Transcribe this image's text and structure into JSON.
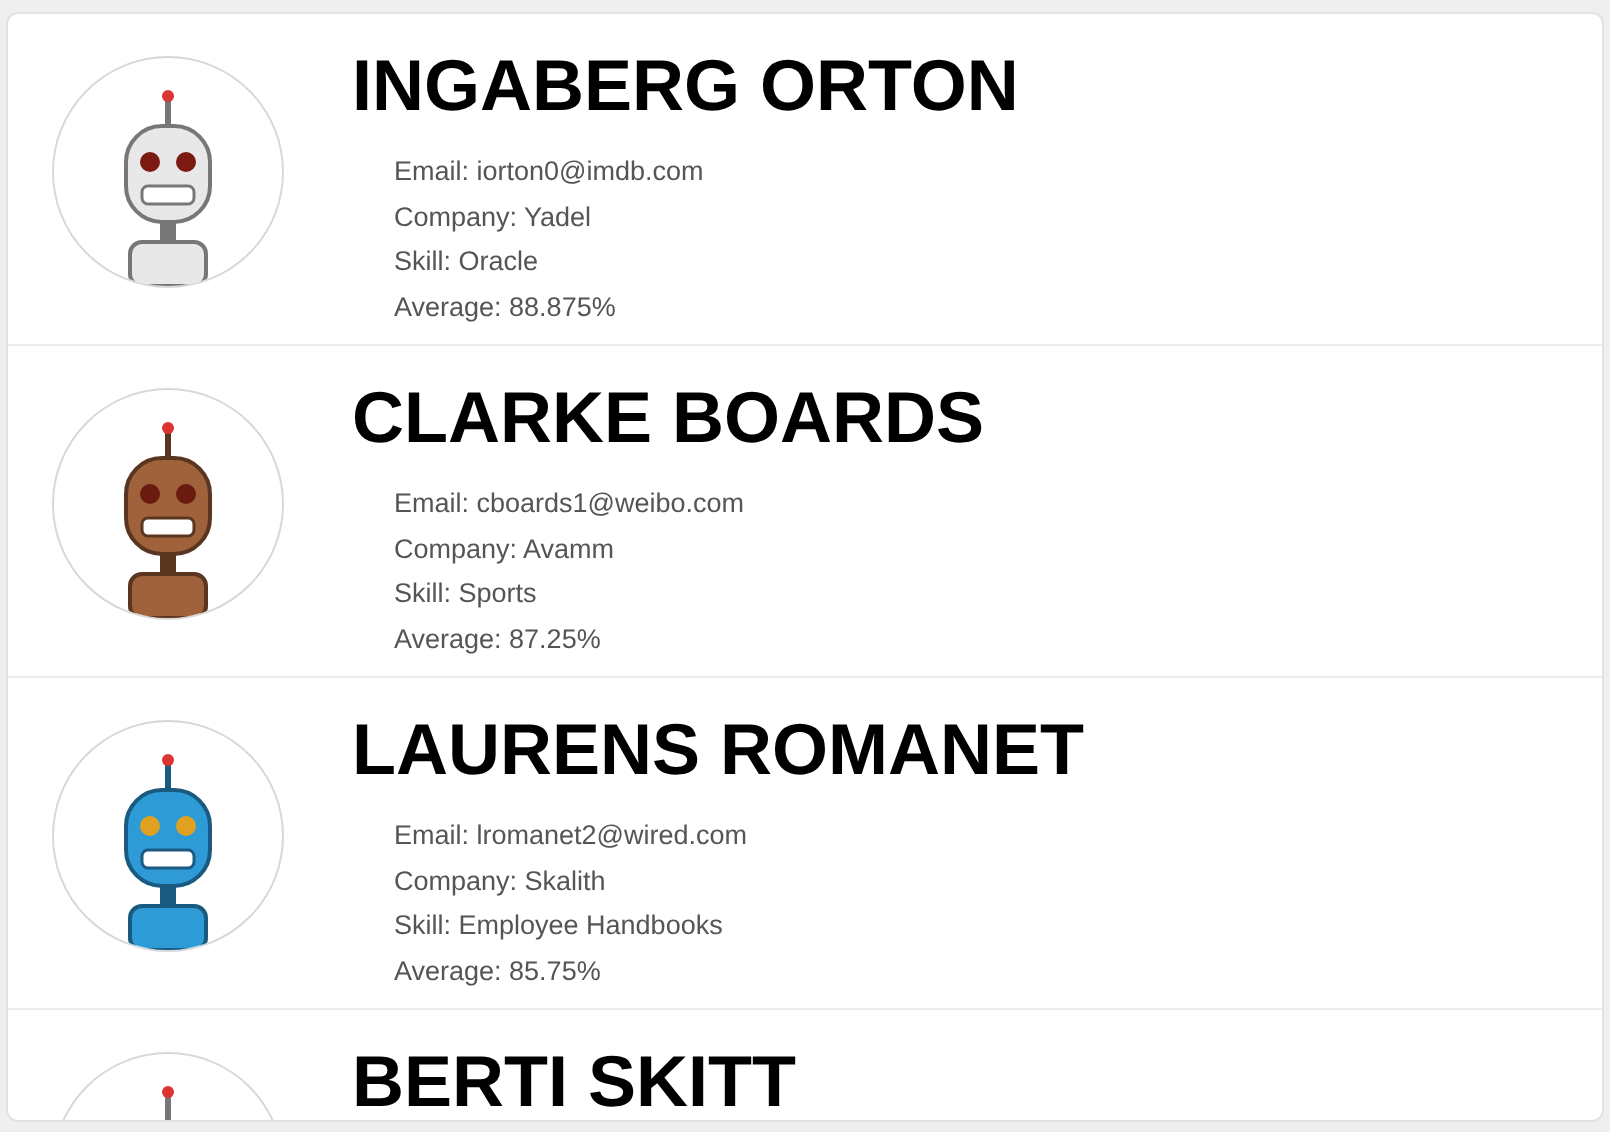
{
  "students": [
    {
      "name": "INGABERG ORTON",
      "details": [
        "Email: iorton0@imdb.com",
        "Company: Yadel",
        "Skill: Oracle",
        "Average: 88.875%"
      ]
    },
    {
      "name": "CLARKE BOARDS",
      "details": [
        "Email: cboards1@weibo.com",
        "Company: Avamm",
        "Skill: Sports",
        "Average: 87.25%"
      ]
    },
    {
      "name": "LAURENS ROMANET",
      "details": [
        "Email: lromanet2@wired.com",
        "Company: Skalith",
        "Skill: Employee Handbooks",
        "Average: 85.75%"
      ]
    },
    {
      "name": "BERTI SKITT"
    }
  ]
}
